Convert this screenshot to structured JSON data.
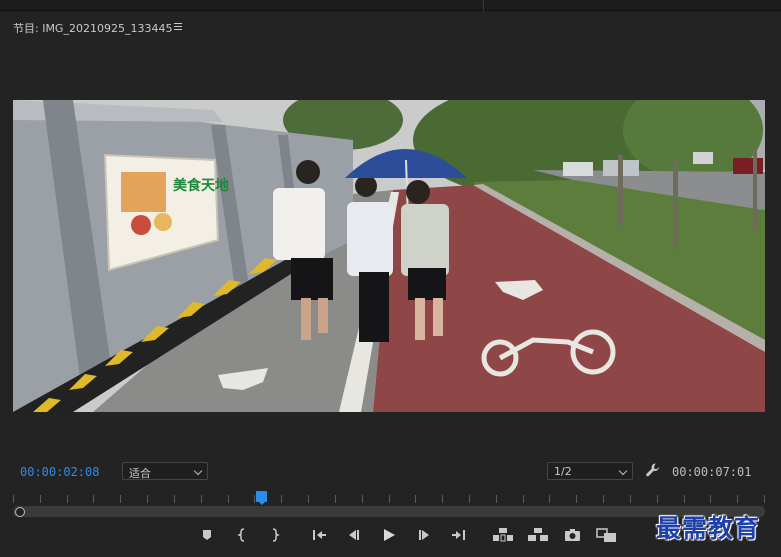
{
  "panel": {
    "title": "节目: IMG_20210925_133445"
  },
  "controls": {
    "current_timecode": "00:00:02:08",
    "fit_select": "适合",
    "resolution_select": "1/2",
    "total_duration": "00:00:07:01"
  },
  "playhead": {
    "position_fraction": 0.33
  },
  "transport": [
    {
      "name": "add-marker-button",
      "icon": "marker-icon"
    },
    {
      "name": "mark-in-button",
      "icon": "mark-in-icon"
    },
    {
      "name": "mark-out-button",
      "icon": "mark-out-icon"
    },
    {
      "name": "go-to-in-button",
      "icon": "go-to-in-icon"
    },
    {
      "name": "step-back-button",
      "icon": "step-back-icon"
    },
    {
      "name": "play-button",
      "icon": "play-icon"
    },
    {
      "name": "step-forward-button",
      "icon": "step-forward-icon"
    },
    {
      "name": "go-to-out-button",
      "icon": "go-to-out-icon"
    },
    {
      "name": "lift-button",
      "icon": "lift-icon"
    },
    {
      "name": "extract-button",
      "icon": "extract-icon"
    },
    {
      "name": "export-frame-button",
      "icon": "camera-icon"
    },
    {
      "name": "compare-view-button",
      "icon": "compare-icon"
    }
  ],
  "video": {
    "poster_text": "美食天地"
  },
  "watermark": {
    "text": "最需教育"
  },
  "colors": {
    "accent": "#2d8ceb",
    "panel_bg": "#232323"
  }
}
